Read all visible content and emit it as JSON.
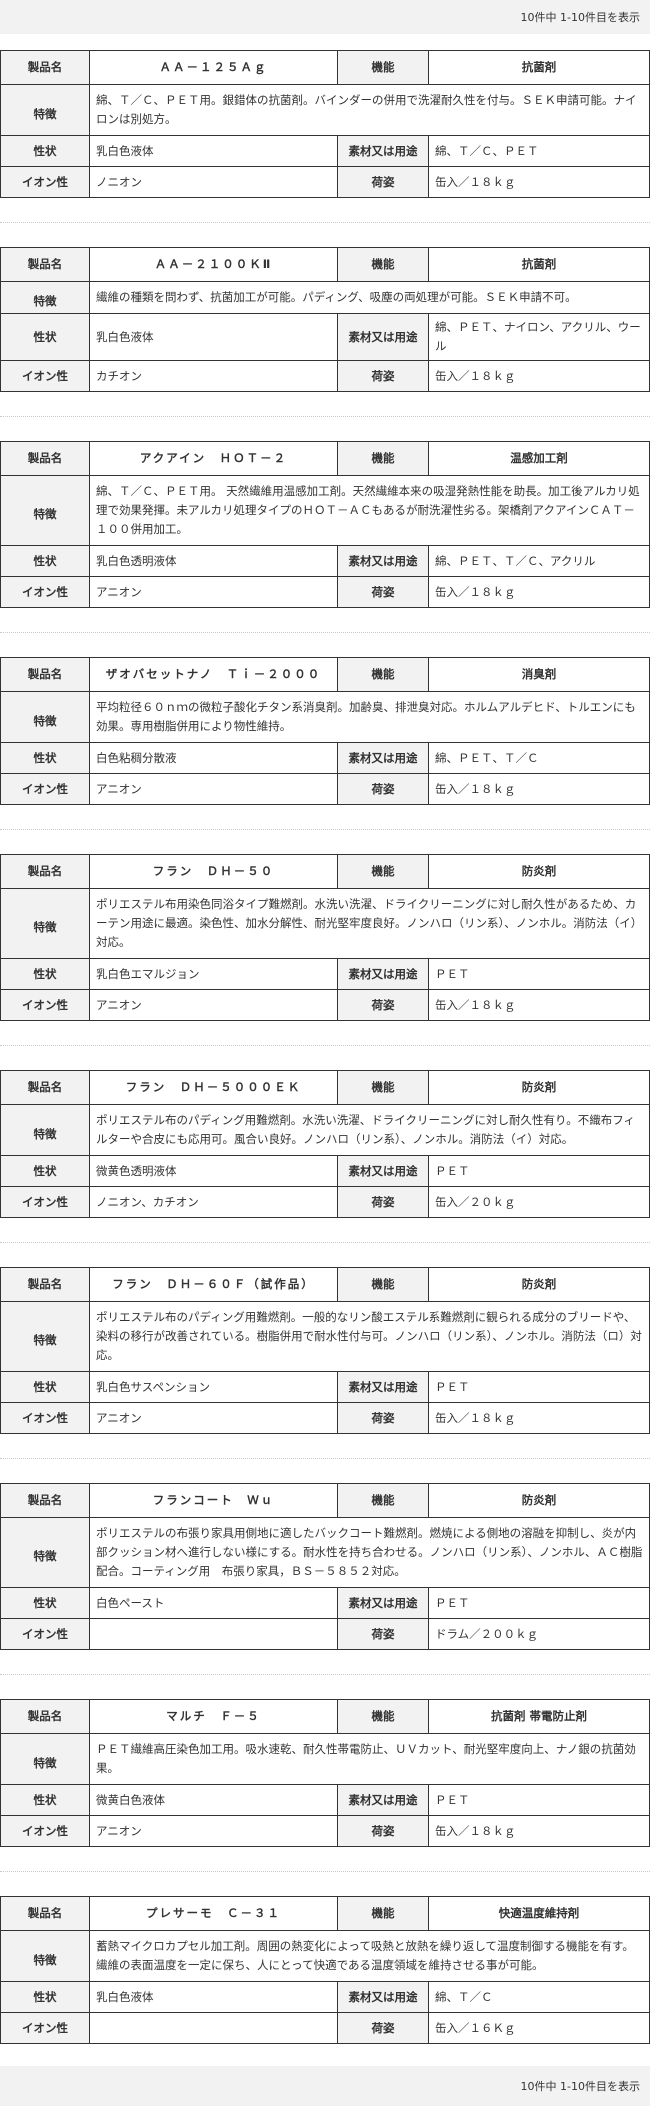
{
  "pager": {
    "text": "10件中 1-10件目を表示"
  },
  "labels": {
    "name": "製品名",
    "func": "機能",
    "feature": "特徴",
    "property": "性状",
    "material": "素材又は用途",
    "ion": "イオン性",
    "package": "荷姿"
  },
  "products": [
    {
      "name": "ＡＡ－１２５Ａｇ",
      "func": "抗菌剤",
      "feature": "綿、Ｔ／Ｃ、ＰＥＴ用。銀錯体の抗菌剤。バインダーの併用で洗濯耐久性を付与。ＳＥＫ申請可能。ナイロンは別処方。",
      "property": "乳白色液体",
      "material": "綿、Ｔ／Ｃ、ＰＥＴ",
      "ion": "ノニオン",
      "package": "缶入／１８ｋｇ"
    },
    {
      "name": "ＡＡ－２１００ＫⅡ",
      "func": "抗菌剤",
      "feature": "繊維の種類を問わず、抗菌加工が可能。パディング、吸塵の両処理が可能。ＳＥＫ申請不可。",
      "property": "乳白色液体",
      "material": "綿、ＰＥＴ、ナイロン、アクリル、ウール",
      "ion": "カチオン",
      "package": "缶入／１８ｋｇ"
    },
    {
      "name": "アクアイン　ＨＯＴ－２",
      "func": "温感加工剤",
      "feature": "綿、Ｔ／Ｃ、ＰＥＴ用。 天然繊維用温感加工剤。天然繊維本来の吸湿発熱性能を助長。加工後アルカリ処理で効果発揮。未アルカリ処理タイプのＨＯＴ－ＡＣもあるが耐洗濯性劣る。架橋剤アクアインＣＡＴ－１００併用加工。",
      "property": "乳白色透明液体",
      "material": "綿、ＰＥＴ、Ｔ／Ｃ、アクリル",
      "ion": "アニオン",
      "package": "缶入／１８ｋｇ"
    },
    {
      "name": "ザオバセットナノ　Ｔｉ－２０００",
      "func": "消臭剤",
      "feature": "平均粒径６０ｎｍの微粒子酸化チタン系消臭剤。加齢臭、排泄臭対応。ホルムアルデヒド、トルエンにも効果。専用樹脂併用により物性維持。",
      "property": "白色粘稠分散液",
      "material": "綿、ＰＥＴ、Ｔ／Ｃ",
      "ion": "アニオン",
      "package": "缶入／１８ｋｇ"
    },
    {
      "name": "フラン　ＤＨ－５０",
      "func": "防炎剤",
      "feature": "ポリエステル布用染色同浴タイプ難燃剤。水洗い洗濯、ドライクリーニングに対し耐久性があるため、カーテン用途に最適。染色性、加水分解性、耐光堅牢度良好。ノンハロ（リン系）、ノンホル。消防法（イ）対応。",
      "property": "乳白色エマルジョン",
      "material": "ＰＥＴ",
      "ion": "アニオン",
      "package": "缶入／１８ｋｇ"
    },
    {
      "name": "フラン　ＤＨ－５０００ＥＫ",
      "func": "防炎剤",
      "feature": "ポリエステル布のパディング用難燃剤。水洗い洗濯、ドライクリーニングに対し耐久性有り。不織布フィルターや合皮にも応用可。風合い良好。ノンハロ（リン系）、ノンホル。消防法（イ）対応。",
      "property": "微黄色透明液体",
      "material": "ＰＥＴ",
      "ion": "ノニオン、カチオン",
      "package": "缶入／２０ｋｇ"
    },
    {
      "name": "フラン　ＤＨ－６０Ｆ（試作品）",
      "func": "防炎剤",
      "feature": "ポリエステル布のパディング用難燃剤。一般的なリン酸エステル系難燃剤に観られる成分のブリードや、染料の移行が改善されている。樹脂併用で耐水性付与可。ノンハロ（リン系）、ノンホル。消防法（ロ）対応。",
      "property": "乳白色サスペンション",
      "material": "ＰＥＴ",
      "ion": "アニオン",
      "package": "缶入／１８ｋｇ"
    },
    {
      "name": "フランコート　Ｗｕ",
      "func": "防炎剤",
      "feature": "ポリエステルの布張り家具用側地に適したバックコート難燃剤。燃焼による側地の溶融を抑制し、炎が内部クッション材へ進行しない様にする。耐水性を持ち合わせる。ノンハロ（リン系）、ノンホル、ＡＣ樹脂配合。コーティング用　布張り家具，ＢＳ－５８５２対応。",
      "property": "白色ペースト",
      "material": "ＰＥＴ",
      "ion": "",
      "package": "ドラム／２００ｋｇ"
    },
    {
      "name": "マルチ　Ｆ－５",
      "func": "抗菌剤 帯電防止剤",
      "feature": "ＰＥＴ繊維高圧染色加工用。吸水速乾、耐久性帯電防止、ＵＶカット、耐光堅牢度向上、ナノ銀の抗菌効果。",
      "property": "微黄白色液体",
      "material": "ＰＥＴ",
      "ion": "アニオン",
      "package": "缶入／１８ｋｇ"
    },
    {
      "name": "プレサーモ　Ｃ－３１",
      "func": "快適温度維持剤",
      "feature": "蓄熱マイクロカプセル加工剤。周囲の熱変化によって吸熱と放熱を繰り返して温度制御する機能を有す。繊維の表面温度を一定に保ち、人にとって快適である温度領域を維持させる事が可能。",
      "property": "乳白色液体",
      "material": "綿、Ｔ／Ｃ",
      "ion": "",
      "package": "缶入／１６Ｋｇ"
    }
  ]
}
